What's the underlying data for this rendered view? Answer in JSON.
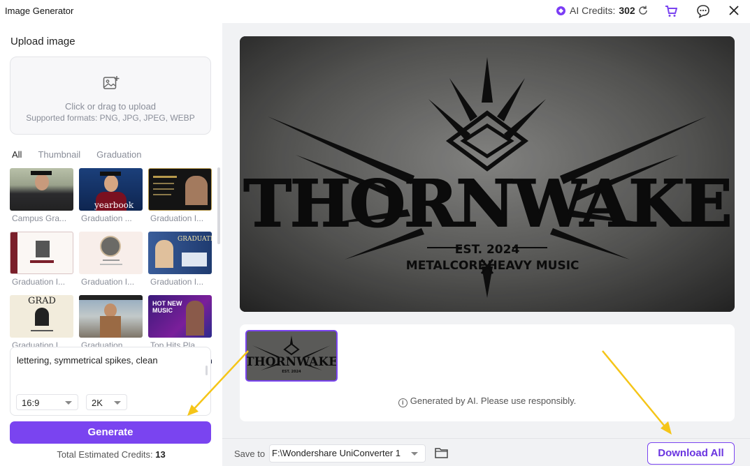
{
  "app": {
    "title": "Image Generator"
  },
  "header": {
    "credits_label": "AI Credits:",
    "credits_value": "302"
  },
  "upload": {
    "title": "Upload image",
    "hint_line1": "Click or drag to upload",
    "hint_line2": "Supported formats: PNG, JPG, JPEG, WEBP"
  },
  "tabs": [
    "All",
    "Thumbnail",
    "Graduation"
  ],
  "templates": [
    {
      "label": "Campus Gra..."
    },
    {
      "label": "Graduation ...",
      "overlay": "yearbook"
    },
    {
      "label": "Graduation I..."
    },
    {
      "label": "Graduation I..."
    },
    {
      "label": "Graduation I..."
    },
    {
      "label": "Graduation I...",
      "overlay": "GRADUATION"
    },
    {
      "label": "Graduation I...",
      "overlay": "GRAD"
    },
    {
      "label": "Graduation ..."
    },
    {
      "label": "Top Hits Pla...",
      "overlay": "HOT NEW MUSIC"
    }
  ],
  "prompt": {
    "text": "lettering, symmetrical spikes, clean",
    "aspect_ratio": "16:9",
    "resolution": "2K"
  },
  "generate": {
    "label": "Generate",
    "total_label": "Total Estimated Credits:",
    "total_value": "13"
  },
  "preview": {
    "logo_text": "THORNWAKE",
    "est_text": "EST. 2024",
    "tagline_left": "METALCORE",
    "tagline_right": "HEAVY MUSIC"
  },
  "results": {
    "disclaimer": "Generated by AI. Please use responsibly."
  },
  "bottom": {
    "save_label": "Save to",
    "path": "F:\\Wondershare UniConverter 1",
    "download_all": "Download All"
  },
  "colors": {
    "accent": "#7a44f0",
    "annotation_arrow": "#f5c518"
  }
}
